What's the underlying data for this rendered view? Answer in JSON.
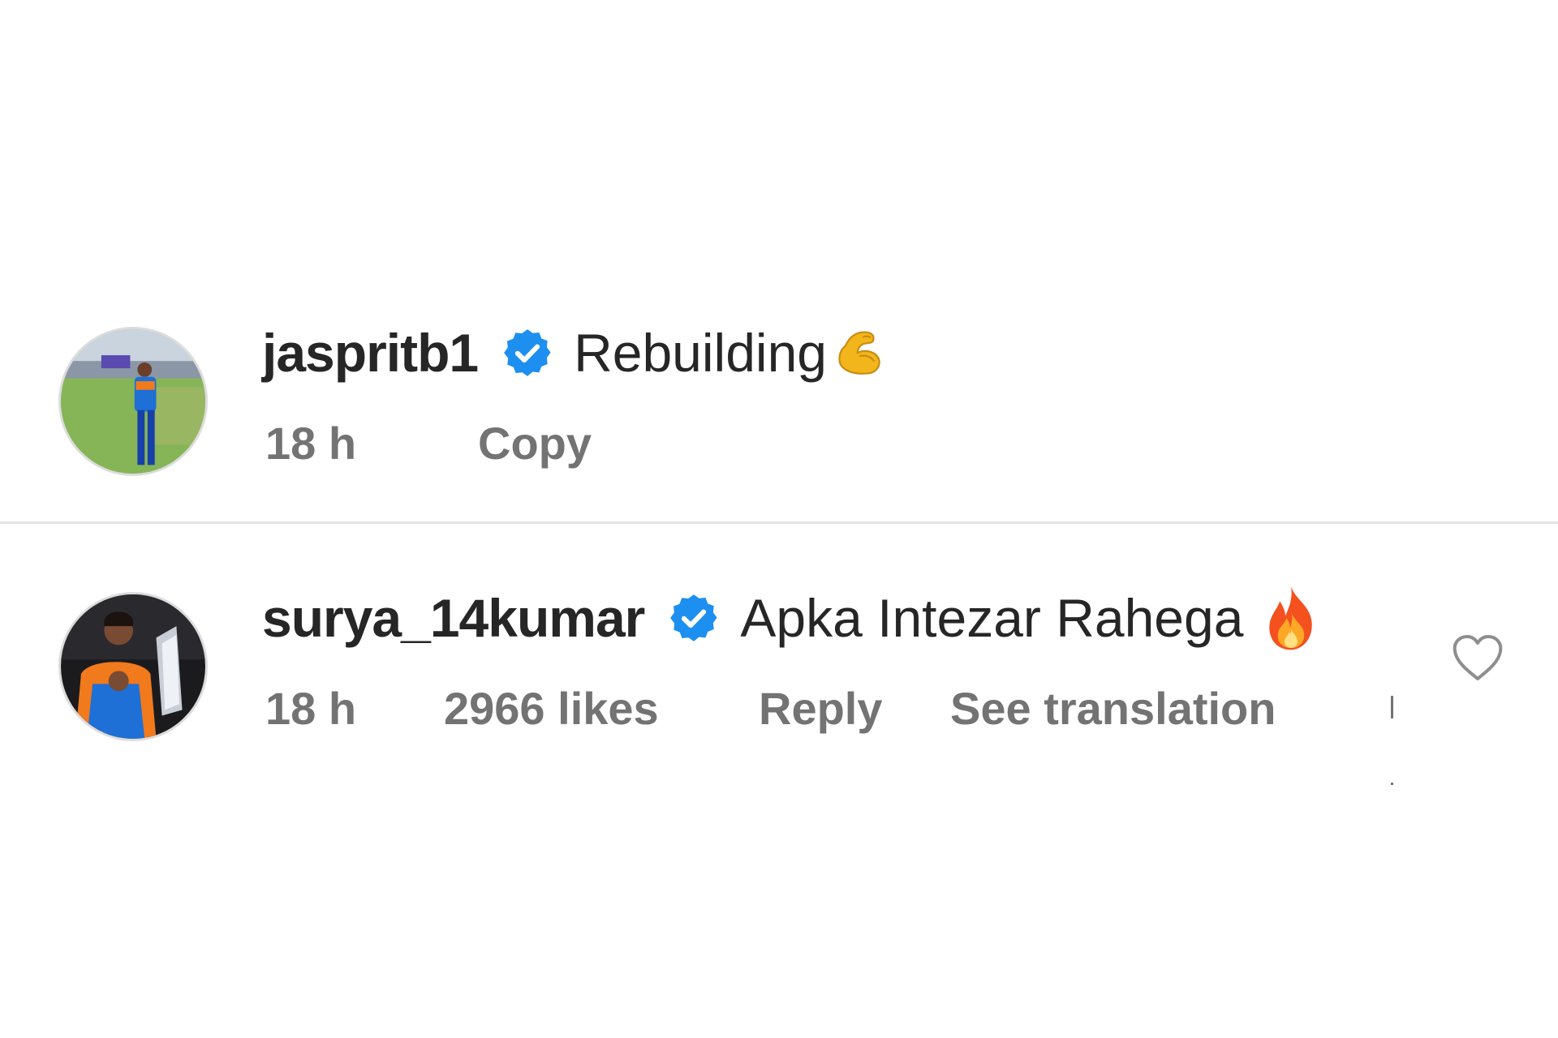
{
  "comments": [
    {
      "username": "jaspritb1",
      "verified_icon": "verified-badge-icon",
      "text": "Rebuilding",
      "emoji_icon": "flexed-biceps-emoji",
      "time": "18 h",
      "action": "Copy"
    },
    {
      "username": "surya_14kumar",
      "verified_icon": "verified-badge-icon",
      "text": "Apka Intezar Rahega",
      "emoji_icon": "fire-emoji",
      "time": "18 h",
      "likes": "2966 likes",
      "reply": "Reply",
      "translate": "See translation",
      "like_icon": "heart-outline-icon"
    }
  ],
  "colors": {
    "verified_blue": "#1d8ff0",
    "meta_gray": "#737373",
    "text_dark": "#262626",
    "divider": "#e4e4e4"
  }
}
